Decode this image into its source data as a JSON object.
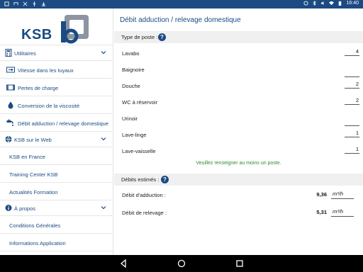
{
  "status_bar": {
    "time": "16:40",
    "left_icons": [
      "notification-icon",
      "cast-icon",
      "no-sim-icon",
      "usb-icon",
      "download-icon"
    ],
    "right_icons": [
      "battery-saver-icon",
      "bluetooth-icon",
      "mute-icon",
      "wifi-icon",
      "battery-icon"
    ]
  },
  "sidebar": {
    "logo_text": "KSB",
    "sections": [
      {
        "label": "Utilitaires",
        "icon": "calculator-icon",
        "items": [
          {
            "label": "Vitesse dans les tuyaux",
            "icon": "pipe-speed-icon"
          },
          {
            "label": "Pertes de charge",
            "icon": "pipe-loss-icon"
          },
          {
            "label": "Conversion de la viscosité",
            "icon": "drop-icon"
          },
          {
            "label": "Débit adduction / relevage domestique",
            "icon": "faucet-icon"
          }
        ]
      },
      {
        "label": "KSB sur le Web",
        "icon": "globe-icon",
        "items": [
          {
            "label": "KSB en France"
          },
          {
            "label": "Training Center KSB"
          },
          {
            "label": "Actualités Formation"
          }
        ]
      },
      {
        "label": "À propos",
        "icon": "info-icon",
        "items": [
          {
            "label": "Conditions Générales"
          },
          {
            "label": "Informations Application"
          }
        ]
      }
    ]
  },
  "main": {
    "title": "Débit adduction / relevage domestique",
    "type_header": "Type de poste :",
    "postes": [
      {
        "label": "Lavabo",
        "value": "4"
      },
      {
        "label": "Baignoire",
        "value": ""
      },
      {
        "label": "Douche",
        "value": "2"
      },
      {
        "label": "WC à réservoir",
        "value": "2"
      },
      {
        "label": "Urinoir",
        "value": ""
      },
      {
        "label": "Lave-linge",
        "value": "1"
      },
      {
        "label": "Lave-vaisselle",
        "value": "1"
      }
    ],
    "notice": "Veuillez renseigner au moins un poste.",
    "results_header": "Débits estimés :",
    "results": [
      {
        "label": "Débit d'adduction :",
        "value": "9,36",
        "unit": "m³/h"
      },
      {
        "label": "Débit de relevage :",
        "value": "5,31",
        "unit": "m³/h"
      }
    ],
    "help_symbol": "?"
  },
  "colors": {
    "brand_blue": "#1c4a82",
    "notice_green": "#2e8b2e",
    "header_gray": "#f0f0f0"
  }
}
